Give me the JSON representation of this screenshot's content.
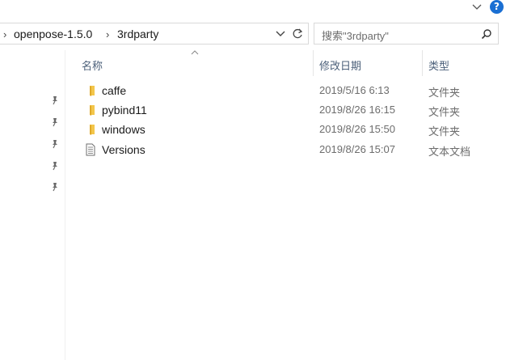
{
  "window": {
    "help_label": "?"
  },
  "address_bar": {
    "breadcrumbs": [
      "openpose-1.5.0",
      "3rdparty"
    ]
  },
  "search": {
    "placeholder": "搜索\"3rdparty\""
  },
  "columns": {
    "name": "名称",
    "date": "修改日期",
    "type": "类型"
  },
  "files": [
    {
      "name": "caffe",
      "date": "2019/5/16 6:13",
      "type": "文件夹",
      "icon": "folder-icon"
    },
    {
      "name": "pybind11",
      "date": "2019/8/26 16:15",
      "type": "文件夹",
      "icon": "folder-icon"
    },
    {
      "name": "windows",
      "date": "2019/8/26 15:50",
      "type": "文件夹",
      "icon": "folder-icon"
    },
    {
      "name": "Versions",
      "date": "2019/8/26 15:07",
      "type": "文本文档",
      "icon": "text-file-icon"
    }
  ],
  "nav_pins": [
    "pin-icon",
    "pin-icon",
    "pin-icon",
    "pin-icon",
    "pin-icon"
  ],
  "colors": {
    "accent": "#1a6fd3",
    "folder": "#f3c64b",
    "header_text": "#4c607a"
  }
}
